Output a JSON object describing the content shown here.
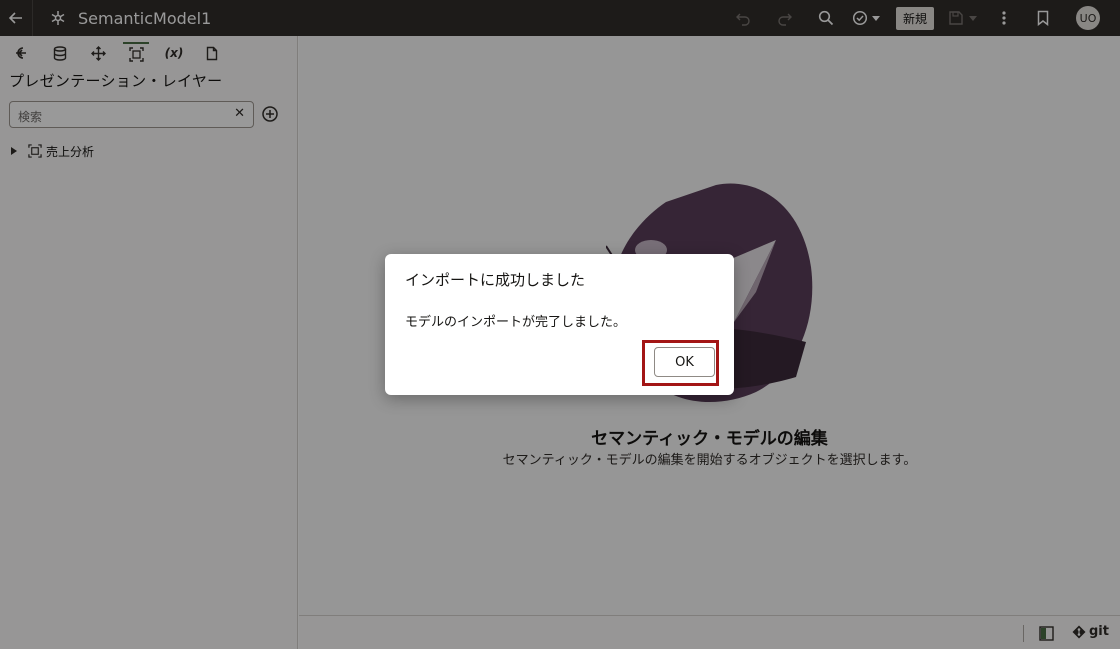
{
  "header": {
    "title": "SemanticModel1",
    "new_label": "新規",
    "avatar_initials": "UO"
  },
  "left_panel": {
    "title": "プレゼンテーション・レイヤー",
    "search_placeholder": "検索",
    "tree": [
      {
        "label": "売上分析"
      }
    ]
  },
  "main": {
    "empty_title": "セマンティック・モデルの編集",
    "empty_subtitle": "セマンティック・モデルの編集を開始するオブジェクトを選択します。"
  },
  "footer": {
    "git_label": "git"
  },
  "dialog": {
    "title": "インポートに成功しました",
    "message": "モデルのインポートが完了しました。",
    "ok_label": "OK"
  },
  "colors": {
    "header_bg": "#312d2a",
    "highlight": "#a31515",
    "active_tab": "#4a6e45"
  }
}
